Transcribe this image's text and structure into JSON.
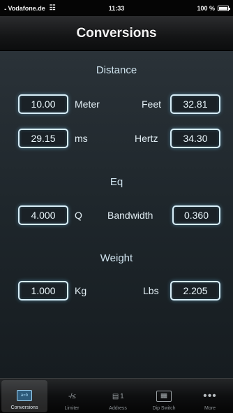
{
  "status_bar": {
    "carrier": "Vodafone.de",
    "signal": "..",
    "time": "11:33",
    "battery": "100 %"
  },
  "nav": {
    "title": "Conversions"
  },
  "sections": {
    "distance": {
      "title": "Distance",
      "meter_value": "10.00",
      "meter_label": "Meter",
      "feet_label": "Feet",
      "feet_value": "32.81",
      "ms_value": "29.15",
      "ms_label": "ms",
      "hertz_label": "Hertz",
      "hertz_value": "34.30"
    },
    "eq": {
      "title": "Eq",
      "q_value": "4.000",
      "q_label": "Q",
      "bandwidth_label": "Bandwidth",
      "bandwidth_value": "0.360"
    },
    "weight": {
      "title": "Weight",
      "kg_value": "1.000",
      "kg_label": "Kg",
      "lbs_label": "Lbs",
      "lbs_value": "2.205"
    }
  },
  "tabs": [
    {
      "label": "Conversions",
      "icon": "conversions-icon",
      "icon_text": "a=b",
      "active": true
    },
    {
      "label": "Limiter",
      "icon": "limiter-icon",
      "icon_text": "-/≤"
    },
    {
      "label": "Address",
      "icon": "address-icon",
      "icon_text": "▤ 1"
    },
    {
      "label": "Dip Switch",
      "icon": "dip-switch-icon",
      "icon_text": "▓▓"
    },
    {
      "label": "More",
      "icon": "more-icon",
      "icon_text": "•••"
    }
  ],
  "colors": {
    "field_border": "#d8eef8",
    "field_glow": "#78c8f0",
    "content_bg": "#1e262b",
    "active_tab_icon": "#2d5a7a"
  }
}
